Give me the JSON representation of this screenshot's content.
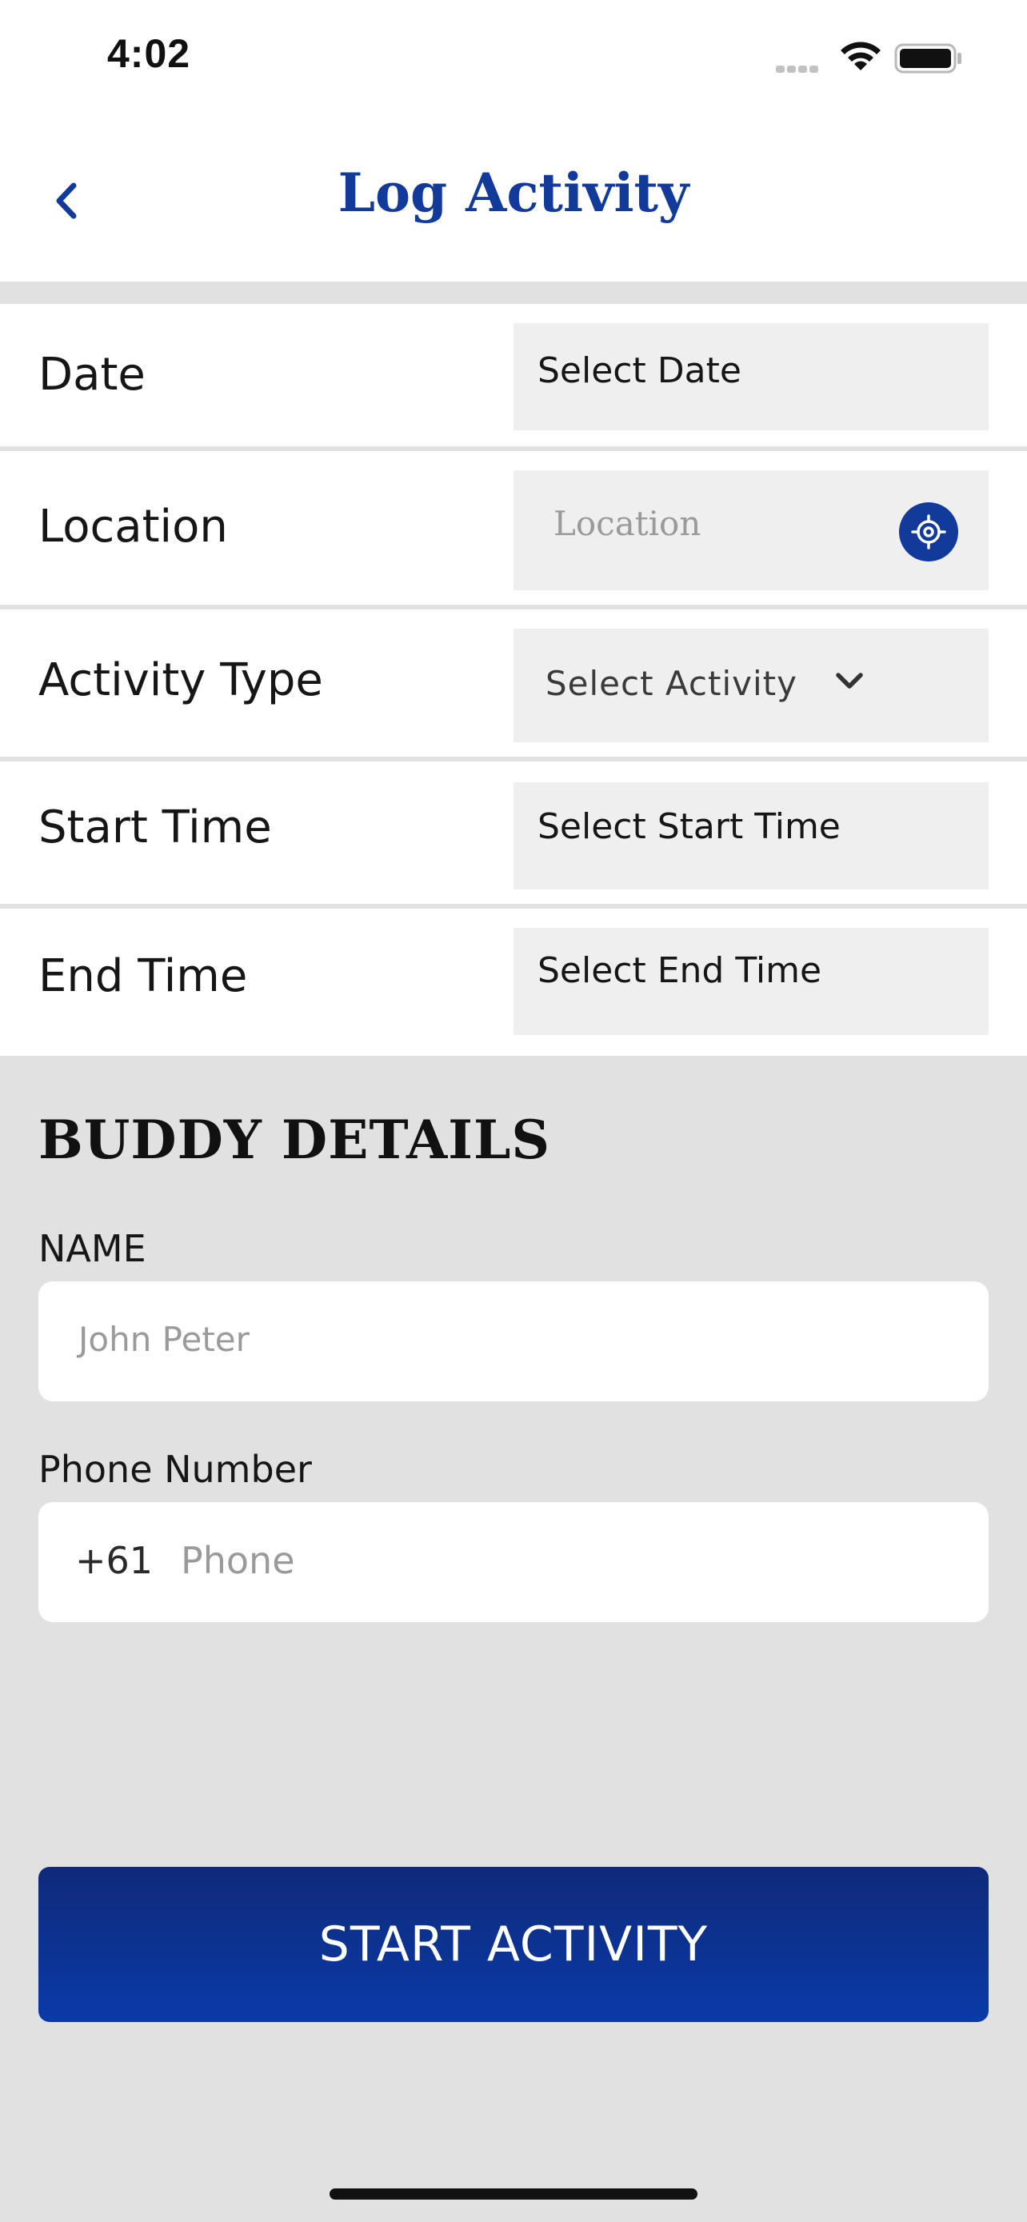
{
  "status_bar": {
    "time": "4:02",
    "icons": [
      "signal-icon",
      "wifi-icon",
      "battery-icon"
    ]
  },
  "nav": {
    "title": "Log Activity",
    "back_icon": "chevron-left-icon"
  },
  "form": {
    "rows": [
      {
        "label": "Date",
        "value": "Select Date"
      },
      {
        "label": "Location",
        "placeholder": "Location",
        "icon": "locate-icon"
      },
      {
        "label": "Activity Type",
        "value": "Select Activity",
        "icon": "chevron-down-icon"
      },
      {
        "label": "Start Time",
        "value": "Select Start Time"
      },
      {
        "label": "End Time",
        "value": "Select End Time"
      }
    ]
  },
  "buddy": {
    "section_title": "BUDDY DETAILS",
    "name_label": "NAME",
    "name_placeholder": "John Peter",
    "phone_label": "Phone Number",
    "country_code": "+61",
    "phone_placeholder": "Phone"
  },
  "cta": {
    "label": "START ACTIVITY"
  },
  "colors": {
    "accent": "#123a9b",
    "background": "#e1e1e1",
    "field": "#efefef"
  }
}
